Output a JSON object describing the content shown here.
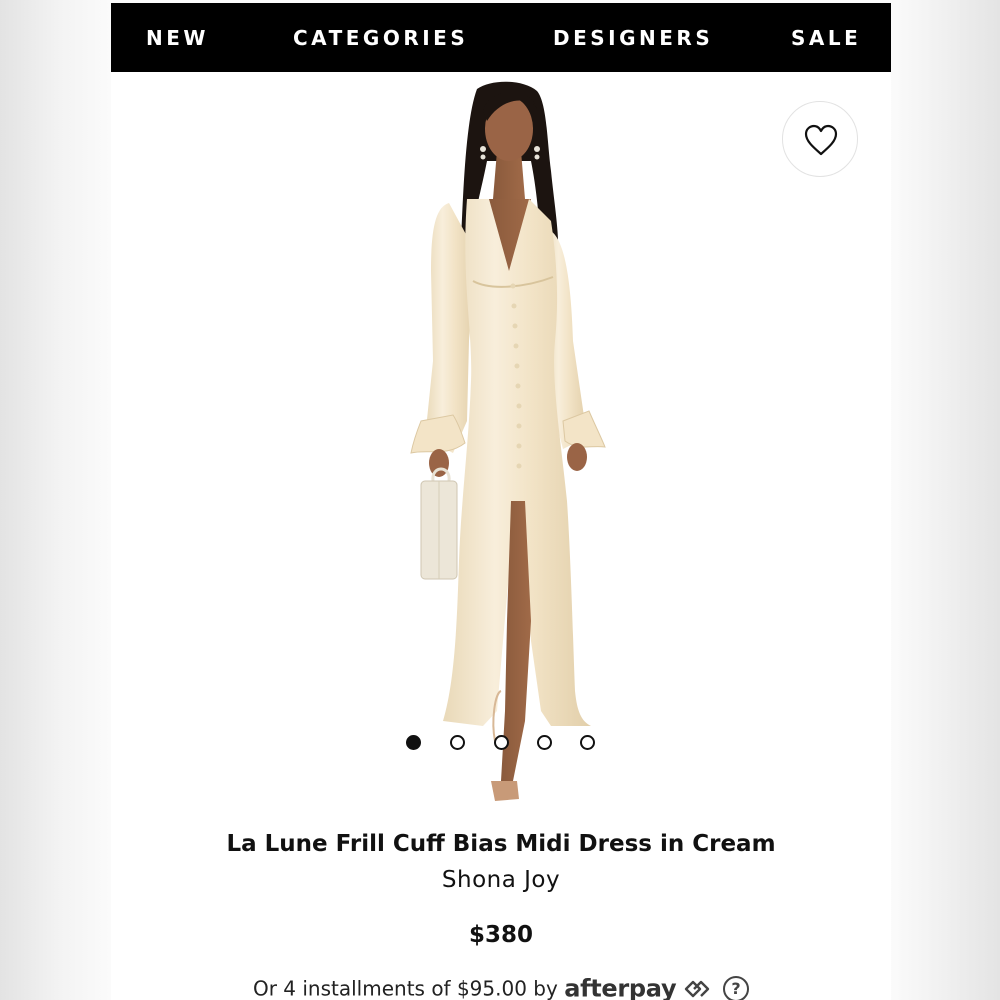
{
  "nav": {
    "items": [
      {
        "label": "NEW"
      },
      {
        "label": "CATEGORIES"
      },
      {
        "label": "DESIGNERS"
      },
      {
        "label": "SALE"
      }
    ]
  },
  "favorite": {
    "icon": "heart-outline-icon"
  },
  "carousel": {
    "total_slides": 5,
    "active_index": 1
  },
  "product": {
    "title": "La Lune Frill Cuff Bias Midi Dress in Cream",
    "brand": "Shona Joy",
    "price": "$380"
  },
  "installments": {
    "text": "Or 4 installments of $95.00 by",
    "provider": "afterpay",
    "help_icon": "question-circle-icon",
    "help_glyph": "?"
  },
  "colors": {
    "nav_background": "#000000",
    "nav_text": "#ffffff",
    "dress": "#f3e6cc",
    "text": "#111111"
  }
}
